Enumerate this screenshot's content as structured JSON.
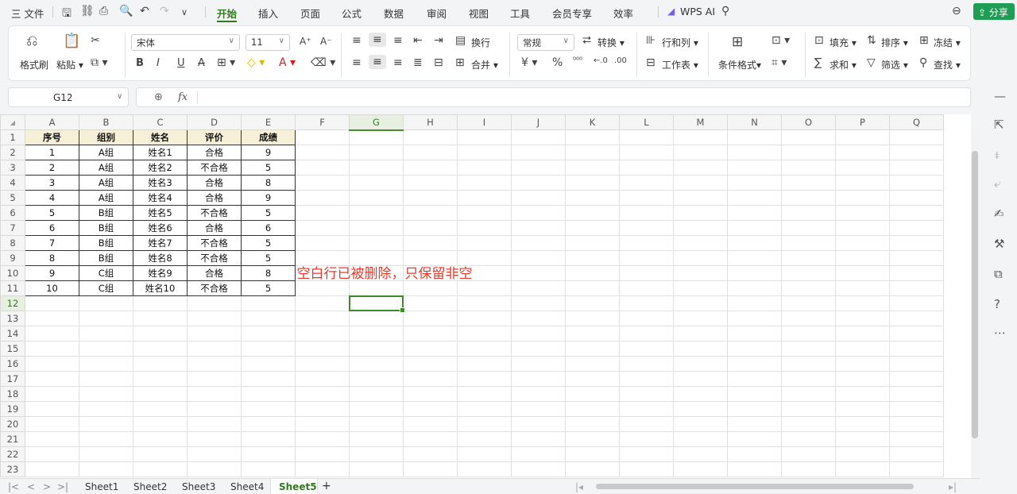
{
  "menubar": {
    "file_label": "三 文件",
    "tabs": [
      "开始",
      "插入",
      "页面",
      "公式",
      "数据",
      "审阅",
      "视图",
      "工具",
      "会员专享",
      "效率"
    ],
    "active_tab": "开始",
    "wps_ai": "WPS AI",
    "share": "分享"
  },
  "ribbon": {
    "format_painter": "格式刷",
    "paste": "粘贴",
    "font_name": "宋体",
    "font_size": "11",
    "wrap": "换行",
    "merge": "合并",
    "number_format": "常规",
    "convert": "转换",
    "row_col": "行和列",
    "worksheet": "工作表",
    "cond_format": "条件格式",
    "fill": "填充",
    "sort": "排序",
    "freeze": "冻结",
    "sum": "求和",
    "filter": "筛选",
    "find": "查找",
    "bold": "B",
    "italic": "I",
    "underline": "U",
    "strike": "A",
    "fx_label": "fx"
  },
  "formula_bar": {
    "cell_ref": "G12",
    "formula": ""
  },
  "sheet": {
    "columns": [
      "A",
      "B",
      "C",
      "D",
      "E",
      "F",
      "G",
      "H",
      "I",
      "J",
      "K",
      "L",
      "M",
      "N",
      "O",
      "P",
      "Q"
    ],
    "selected_column": "G",
    "selected_row": "12",
    "row_numbers": [
      "1",
      "2",
      "3",
      "4",
      "5",
      "6",
      "7",
      "8",
      "9",
      "10",
      "11",
      "12",
      "13",
      "14",
      "15",
      "16",
      "17",
      "18",
      "19",
      "20",
      "21",
      "22",
      "23"
    ],
    "header": [
      "序号",
      "组别",
      "姓名",
      "评价",
      "成绩"
    ],
    "rows": [
      [
        "1",
        "A组",
        "姓名1",
        "合格",
        "9"
      ],
      [
        "2",
        "A组",
        "姓名2",
        "不合格",
        "5"
      ],
      [
        "3",
        "A组",
        "姓名3",
        "合格",
        "8"
      ],
      [
        "4",
        "A组",
        "姓名4",
        "合格",
        "9"
      ],
      [
        "5",
        "B组",
        "姓名5",
        "不合格",
        "5"
      ],
      [
        "6",
        "B组",
        "姓名6",
        "合格",
        "6"
      ],
      [
        "7",
        "B组",
        "姓名7",
        "不合格",
        "5"
      ],
      [
        "8",
        "B组",
        "姓名8",
        "不合格",
        "5"
      ],
      [
        "9",
        "C组",
        "姓名9",
        "合格",
        "8"
      ],
      [
        "10",
        "C组",
        "姓名10",
        "不合格",
        "5"
      ]
    ],
    "note": "空白行已被删除，只保留非空"
  },
  "sheet_tabs": [
    "Sheet1",
    "Sheet2",
    "Sheet3",
    "Sheet4",
    "Sheet5"
  ],
  "active_sheet": "Sheet5",
  "colors": {
    "accent_green": "#2f7a1f",
    "note_red": "#e23b2e",
    "share_btn": "#1f9d55"
  }
}
